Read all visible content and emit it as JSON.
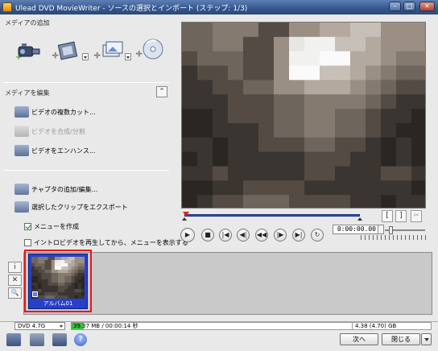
{
  "window": {
    "title": "Ulead DVD MovieWriter - ソースの選択とインポート (ステップ: 1/3)",
    "minimize": "–",
    "maximize": "□",
    "close": "✕"
  },
  "add_media": {
    "section_title": "メディアの追加",
    "buttons": [
      "capture-video",
      "add-video",
      "add-slideshow",
      "import-disc"
    ]
  },
  "edit_media": {
    "section_title": "メディアを編集",
    "collapse_glyph": "⌃",
    "items": [
      {
        "label": "ビデオの複数カット...",
        "enabled": true
      },
      {
        "label": "ビデオを合成/分割",
        "enabled": false
      },
      {
        "label": "ビデオをエンハンス...",
        "enabled": true
      }
    ]
  },
  "other_tasks": {
    "items": [
      {
        "label": "チャプタの追加/編集..."
      },
      {
        "label": "選択したクリップをエクスポート"
      }
    ]
  },
  "options": {
    "create_menu": {
      "label": "メニューを作成",
      "checked": true
    },
    "intro_video": {
      "label": "イントロビデオを再生してから、メニューを表示する",
      "checked": false
    }
  },
  "preview": {
    "trim_in": "[",
    "trim_out": "]",
    "trim_cut": "✂",
    "timecode": "0:00:00.00"
  },
  "playback": {
    "play": "▶",
    "stop": "■",
    "home": "|◀",
    "prev": "◀|",
    "prev_frame": "◀◀",
    "next": "|▶",
    "end": "▶|",
    "repeat": "↻"
  },
  "tray": {
    "side_buttons": [
      "i",
      "✕",
      "🔍"
    ],
    "clips": [
      {
        "label": "アルバム01"
      }
    ]
  },
  "status": {
    "disc_type": "DVD 4.7G",
    "used": "39.37 MB / 00:00:14 秒",
    "total": "4.38 (4.70) GB",
    "used_fraction": 0.033
  },
  "footer": {
    "next_button": "次へ",
    "close_button": "閉じる"
  },
  "colors": {
    "accent": "#2740c9",
    "highlight": "#e8161a",
    "capacity": "#38c238"
  }
}
